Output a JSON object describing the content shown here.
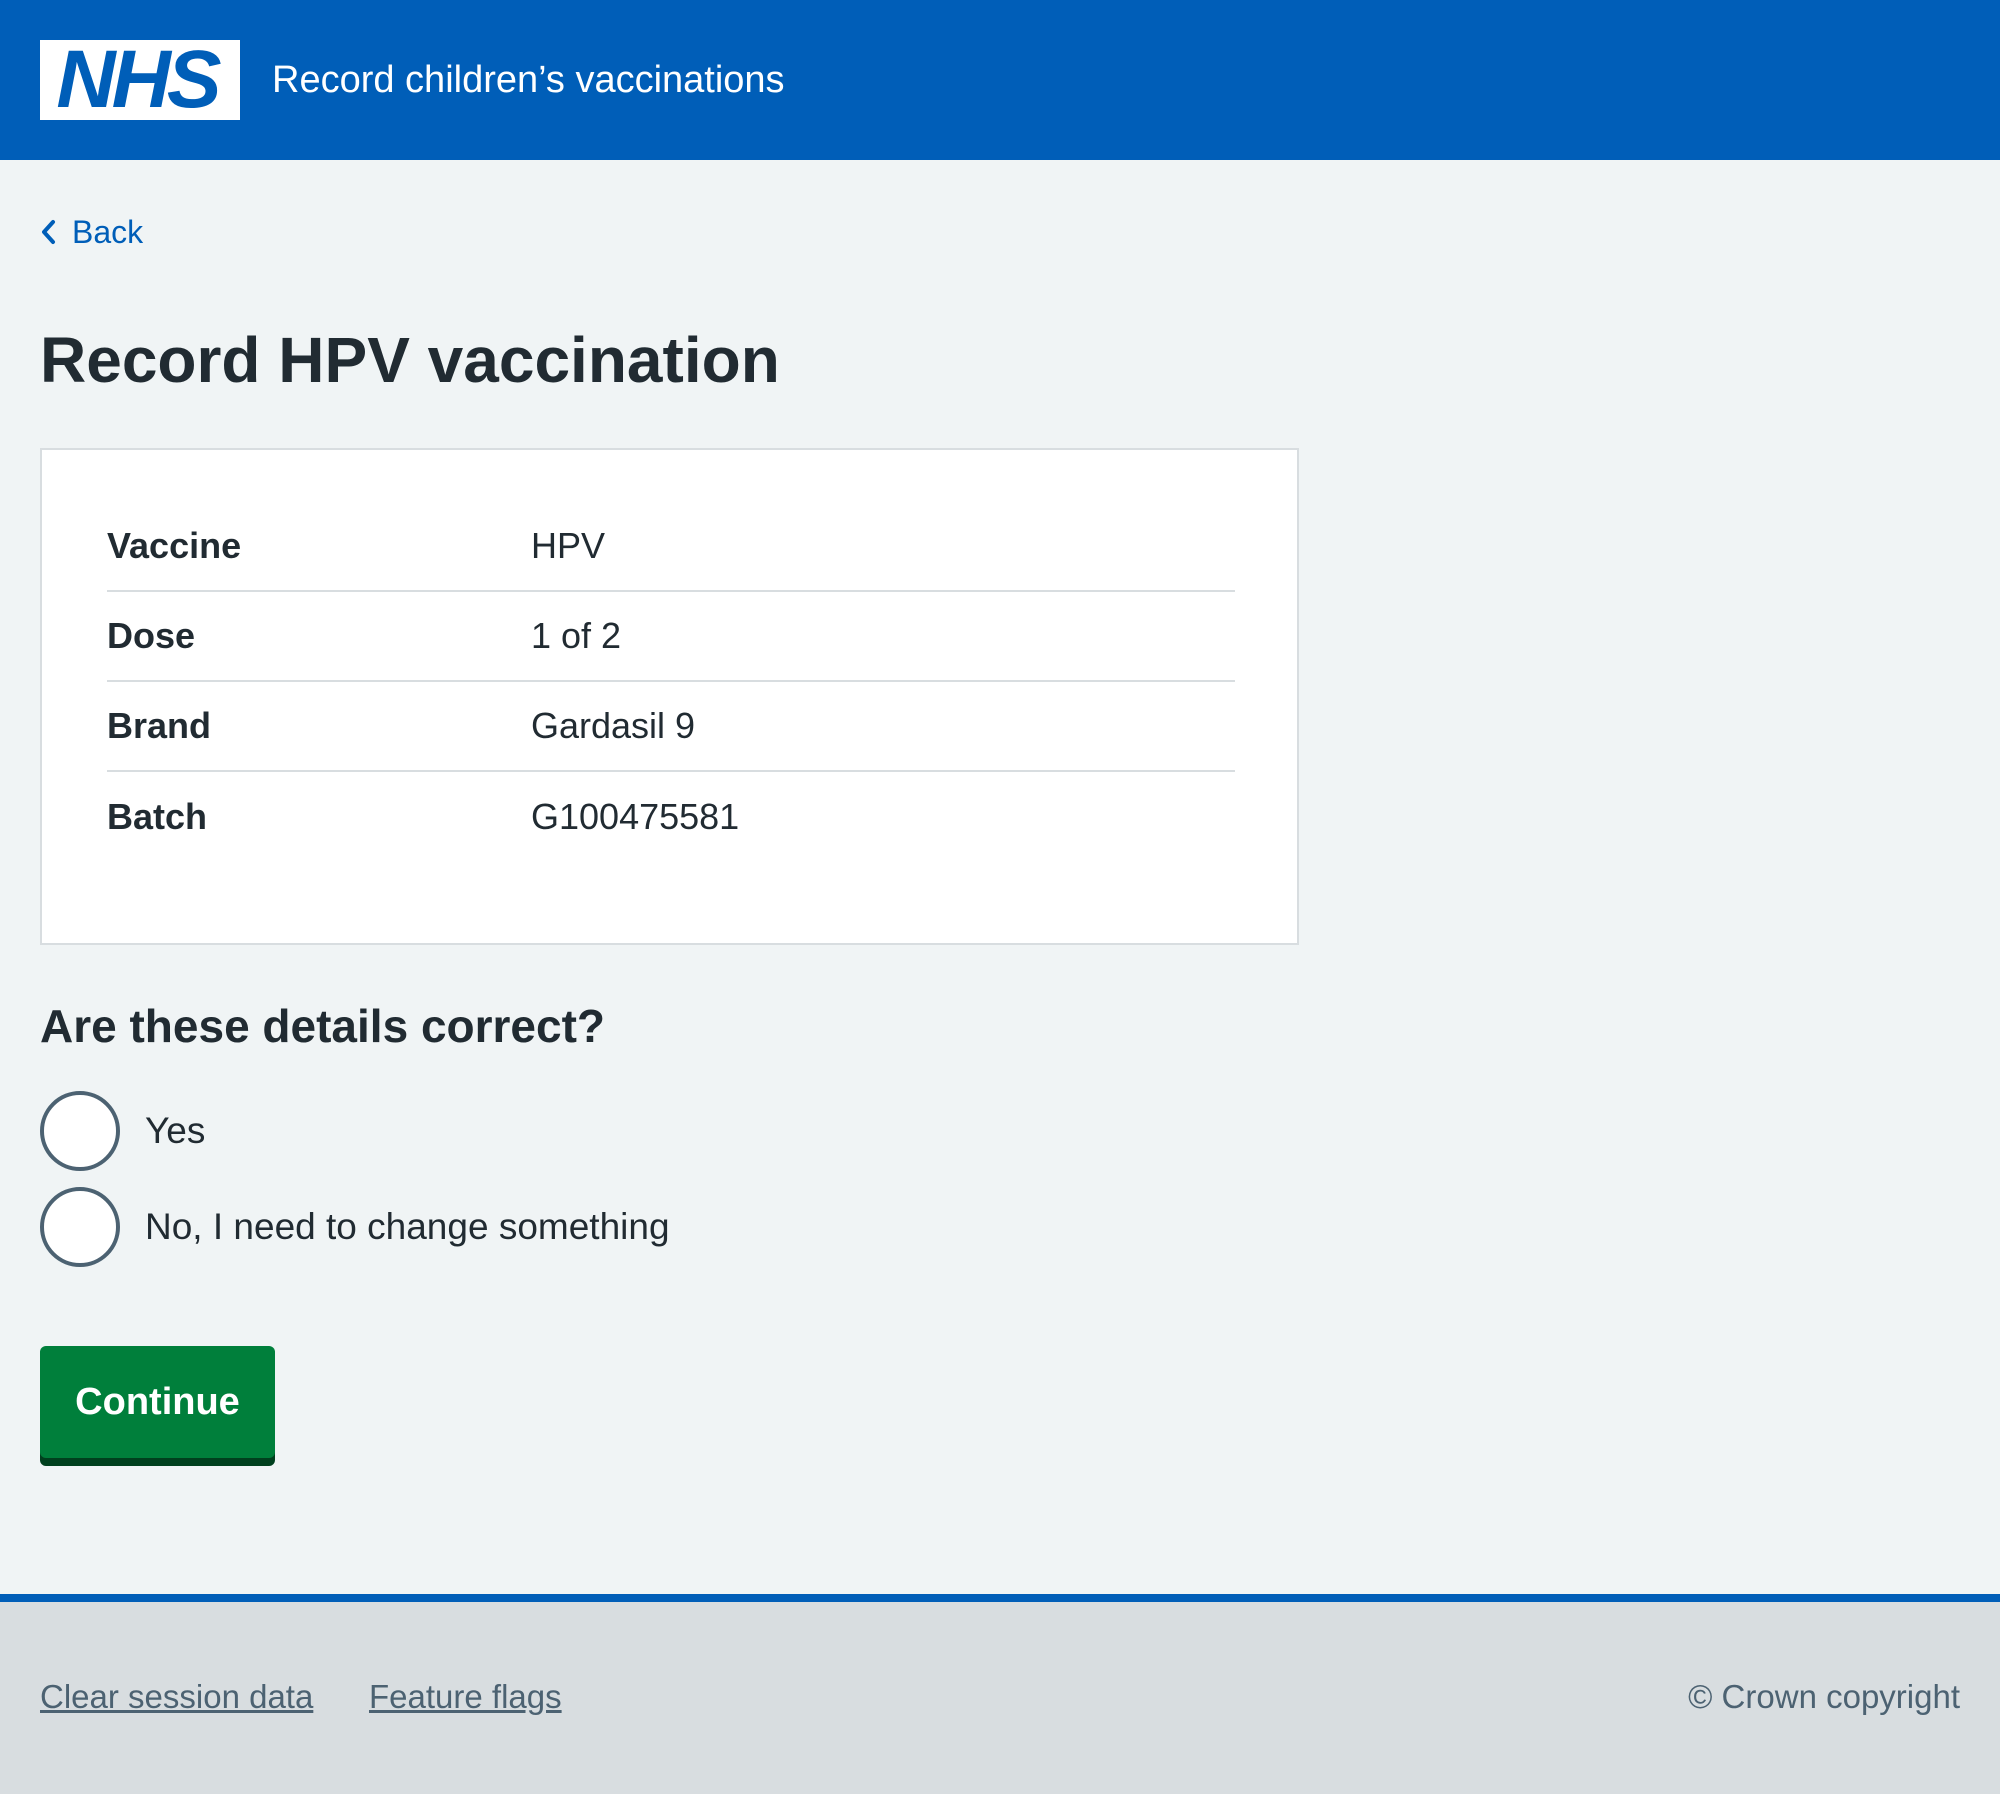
{
  "header": {
    "logo_text": "NHS",
    "service_name": "Record children’s vaccinations",
    "background_color": "#005eb8"
  },
  "back_link": {
    "label": "Back",
    "icon": "chevron-left-icon"
  },
  "page": {
    "title": "Record HPV vaccination"
  },
  "summary": {
    "rows": [
      {
        "key": "Vaccine",
        "value": "HPV"
      },
      {
        "key": "Dose",
        "value": "1 of 2"
      },
      {
        "key": "Brand",
        "value": "Gardasil 9"
      },
      {
        "key": "Batch",
        "value": "G100475581"
      }
    ]
  },
  "question": {
    "legend": "Are these details correct?",
    "options": [
      {
        "label": "Yes",
        "selected": false
      },
      {
        "label": "No, I need to change something",
        "selected": false
      }
    ]
  },
  "actions": {
    "continue_label": "Continue",
    "continue_color": "#007f3b"
  },
  "footer": {
    "links": [
      "Clear session data",
      "Feature flags"
    ],
    "copyright": "© Crown copyright"
  }
}
